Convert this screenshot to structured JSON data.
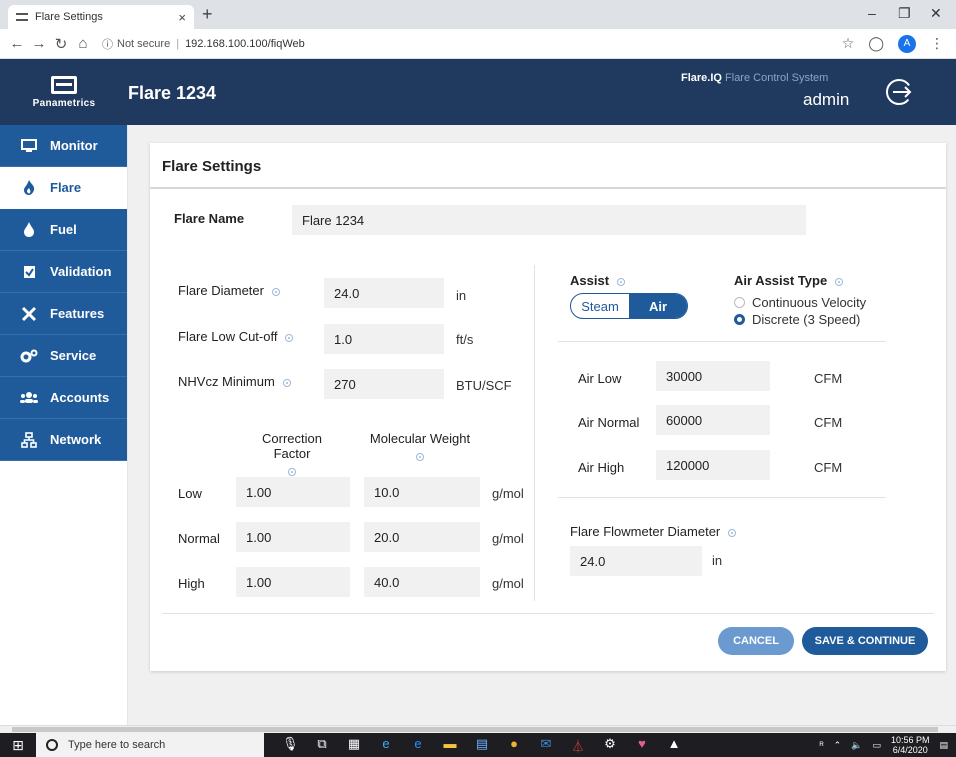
{
  "browser": {
    "tab_title": "Flare Settings",
    "tab_close": "×",
    "new_tab": "+",
    "not_secure": "Not secure",
    "url": "192.168.100.100/fiqWeb",
    "profile_initial": "A"
  },
  "header": {
    "logo_text": "Panametrics",
    "page_title": "Flare 1234",
    "brand_strong": "Flare.IQ",
    "brand_rest": "Flare Control System",
    "user": "admin"
  },
  "sidebar": {
    "items": [
      {
        "label": "Monitor",
        "icon": "monitor-icon"
      },
      {
        "label": "Flare",
        "icon": "flame-icon"
      },
      {
        "label": "Fuel",
        "icon": "drop-icon"
      },
      {
        "label": "Validation",
        "icon": "clipboard-check-icon"
      },
      {
        "label": "Features",
        "icon": "tools-icon"
      },
      {
        "label": "Service",
        "icon": "gears-icon"
      },
      {
        "label": "Accounts",
        "icon": "users-icon"
      },
      {
        "label": "Network",
        "icon": "network-icon"
      }
    ],
    "active": "Flare"
  },
  "card": {
    "title": "Flare Settings",
    "flare_name_label": "Flare Name",
    "flare_name_value": "Flare 1234",
    "diameter_label": "Flare Diameter",
    "diameter_value": "24.0",
    "diameter_unit": "in",
    "cutoff_label": "Flare Low Cut-off",
    "cutoff_value": "1.0",
    "cutoff_unit": "ft/s",
    "nhv_label": "NHVcz Minimum",
    "nhv_value": "270",
    "nhv_unit": "BTU/SCF",
    "cf_header": "Correction Factor",
    "mw_header": "Molecular Weight",
    "rows": [
      {
        "label": "Low",
        "cf": "1.00",
        "mw": "10.0",
        "unit": "g/mol"
      },
      {
        "label": "Normal",
        "cf": "1.00",
        "mw": "20.0",
        "unit": "g/mol"
      },
      {
        "label": "High",
        "cf": "1.00",
        "mw": "40.0",
        "unit": "g/mol"
      }
    ],
    "assist_label": "Assist",
    "assist_options": [
      "Steam",
      "Air"
    ],
    "assist_selected": "Air",
    "air_assist_type_label": "Air Assist Type",
    "air_assist_options": [
      "Continuous Velocity",
      "Discrete (3 Speed)"
    ],
    "air_assist_selected": "Discrete (3 Speed)",
    "air_rows": [
      {
        "label": "Air Low",
        "value": "30000",
        "unit": "CFM"
      },
      {
        "label": "Air Normal",
        "value": "60000",
        "unit": "CFM"
      },
      {
        "label": "Air High",
        "value": "120000",
        "unit": "CFM"
      }
    ],
    "flowmeter_label": "Flare Flowmeter Diameter",
    "flowmeter_value": "24.0",
    "flowmeter_unit": "in",
    "cancel": "CANCEL",
    "save": "SAVE & CONTINUE"
  },
  "taskbar": {
    "search_placeholder": "Type here to search",
    "time": "10:56 PM",
    "date": "6/4/2020"
  },
  "colors": {
    "header_bg": "#1f3a5e",
    "nav_bg": "#1f5a9a",
    "cancel_bg": "#6a9ad0"
  }
}
